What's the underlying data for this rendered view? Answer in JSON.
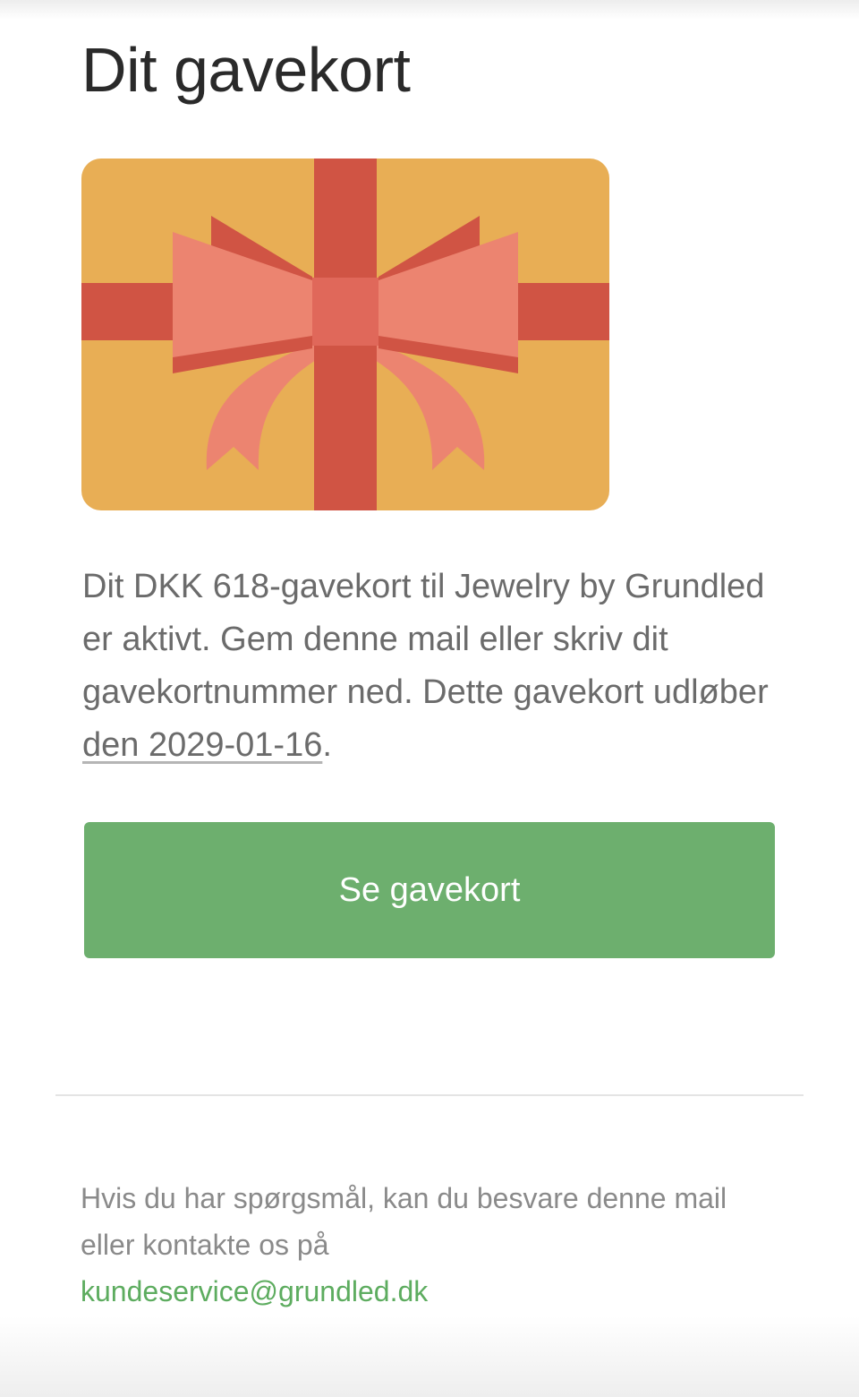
{
  "header": {
    "title": "Dit gavekort"
  },
  "gift_card_image": {
    "icon": "gift-card-bow-icon",
    "colors": {
      "card": "#e8ae55",
      "ribbon": "#d05444",
      "bow": "#ec8470",
      "knot": "#e0685a"
    }
  },
  "message": {
    "intro": "Dit DKK 618-gavekort til Jewelry by Grundled er aktivt. Gem denne mail eller skriv dit gavekortnummer ned. Dette gavekort udløber ",
    "expiry": "den 2029-01-16",
    "end": "."
  },
  "button": {
    "label": "Se gavekort",
    "color": "#6daf6e"
  },
  "footer": {
    "text": "Hvis du har spørgsmål, kan du besvare denne mail eller kontakte os på",
    "email": "kundeservice@grundled.dk",
    "link_color": "#5dac5f"
  }
}
